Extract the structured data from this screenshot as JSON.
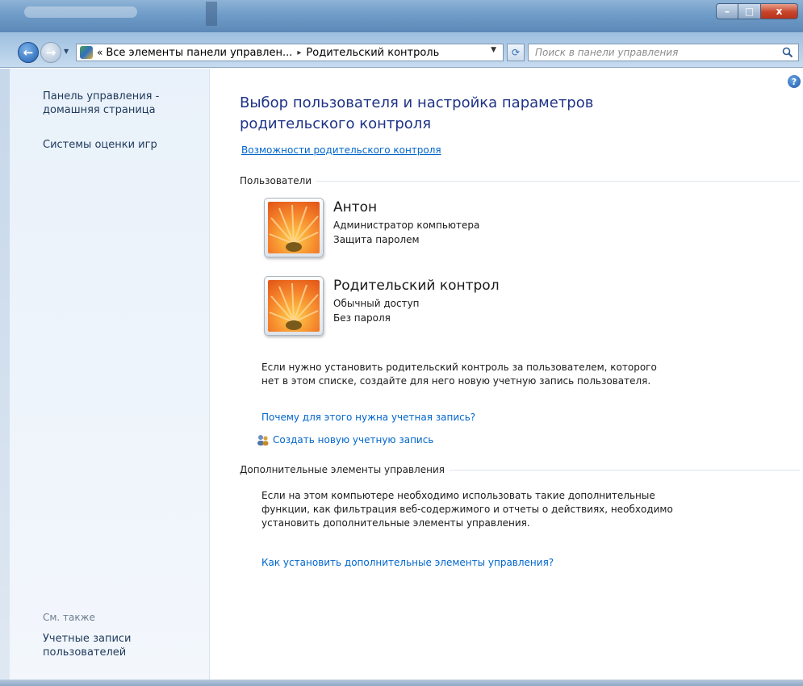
{
  "window": {
    "minimize_label": "–",
    "maximize_label": "□",
    "close_label": "x"
  },
  "address_bar": {
    "path_prefix": "«",
    "segment_1": "Все элементы панели управлен...",
    "separator": "▸",
    "segment_2": "Родительский контроль",
    "search_placeholder": "Поиск в панели управления"
  },
  "left_nav": {
    "home_link": "Панель управления - домашняя страница",
    "game_ratings_link": "Системы оценки игр",
    "see_also_label": "См. также",
    "user_accounts_link": "Учетные записи пользователей"
  },
  "main": {
    "title": "Выбор пользователя и настройка параметров родительского контроля",
    "features_link": "Возможности родительского контроля",
    "users_section_label": "Пользователи",
    "users": [
      {
        "name": "Антон",
        "role": "Администратор компьютера",
        "password": "Защита паролем"
      },
      {
        "name": "Родительский контрол",
        "role": "Обычный доступ",
        "password": "Без пароля"
      }
    ],
    "create_info_text": "Если нужно установить родительский контроль за пользователем, которого нет в этом списке, создайте для него новую учетную запись пользователя.",
    "why_account_link": "Почему для этого нужна учетная запись?",
    "create_account_link": "Создать новую учетную запись",
    "extra_section_label": "Дополнительные элементы управления",
    "extra_info_text": "Если на этом компьютере необходимо использовать такие дополнительные функции, как фильтрация веб-содержимого и отчеты о действиях, необходимо установить дополнительные элементы управления.",
    "install_link": "Как установить дополнительные элементы управления?",
    "help_label": "?"
  }
}
